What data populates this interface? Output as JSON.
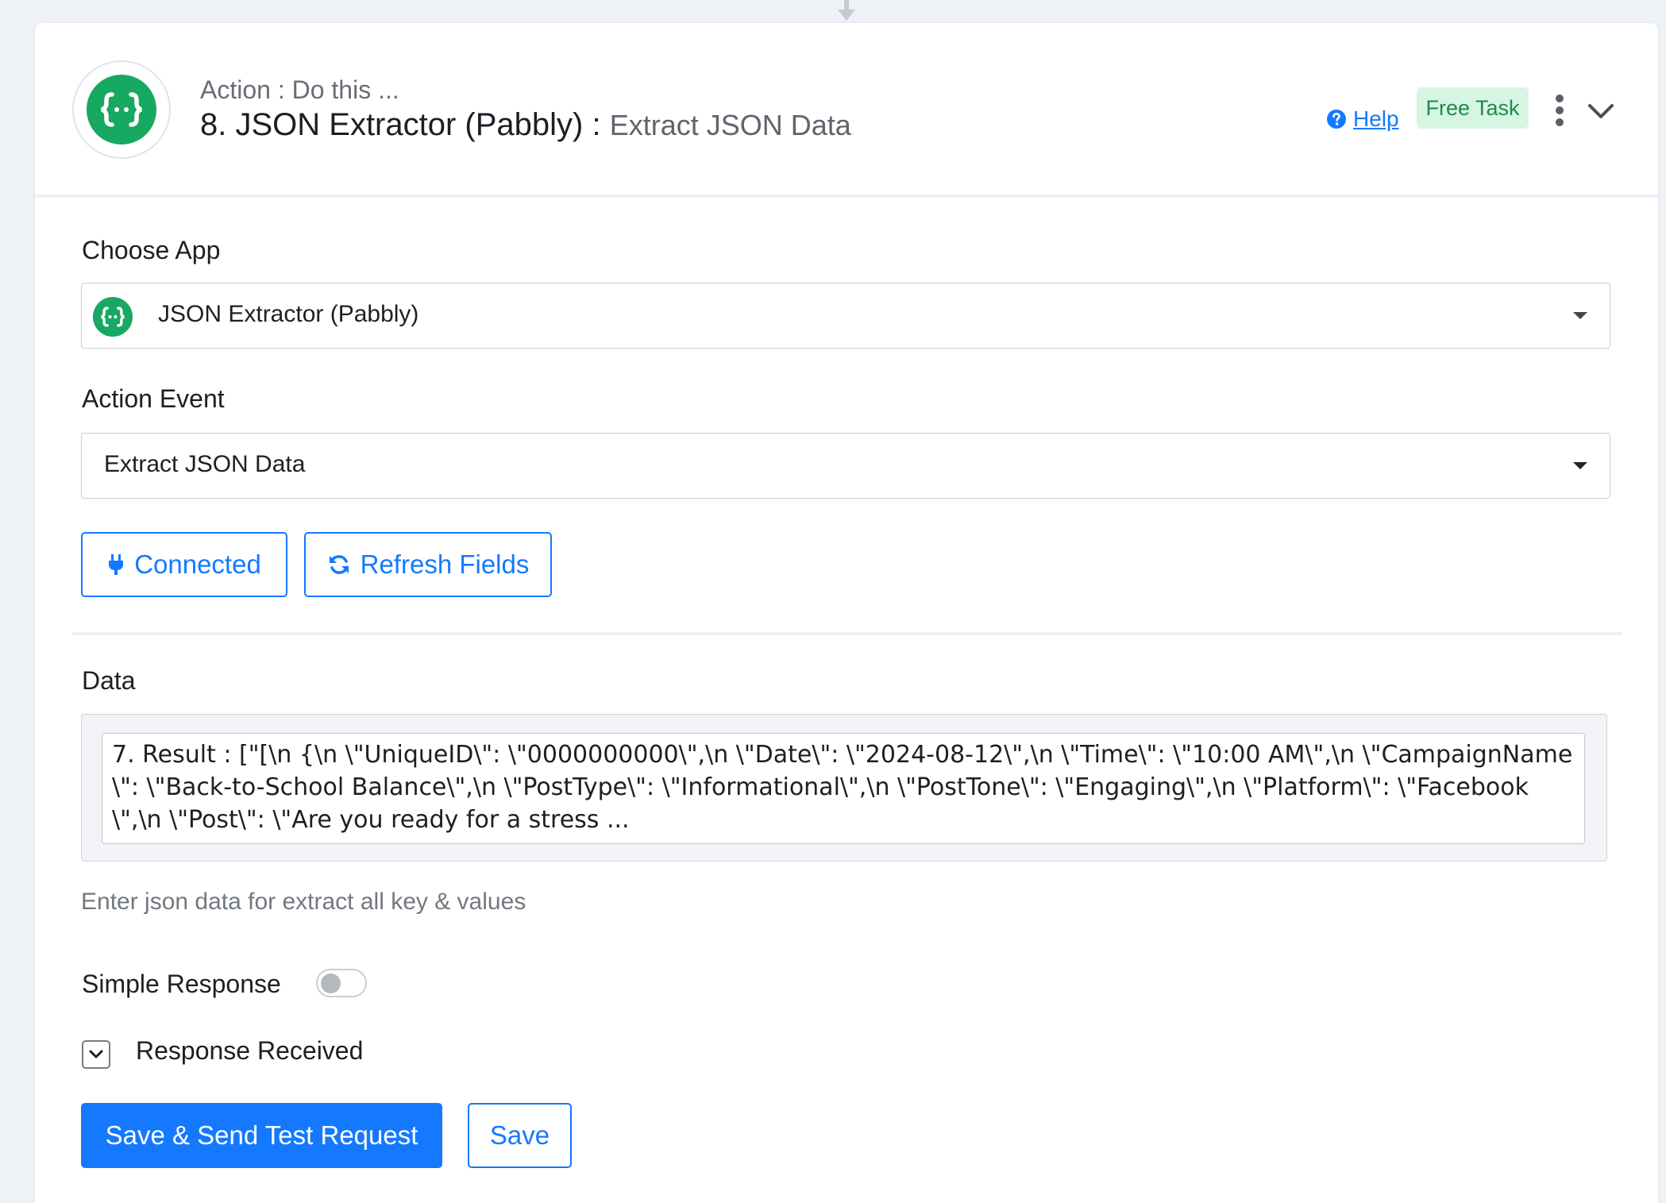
{
  "step": {
    "subtitle": "Action : Do this ...",
    "title_main": "8. JSON Extractor (Pabbly)",
    "title_sep": " : ",
    "title_event": "Extract JSON Data",
    "help_label": "Help",
    "badge": "Free Task"
  },
  "form": {
    "choose_app_label": "Choose App",
    "choose_app_value": "JSON Extractor (Pabbly)",
    "action_event_label": "Action Event",
    "action_event_value": "Extract JSON Data",
    "connected_label": "Connected",
    "refresh_label": "Refresh Fields",
    "data_label": "Data",
    "data_value": "7. Result : [\"[\\n {\\n \\\"UniqueID\\\": \\\"0000000000\\\",\\n \\\"Date\\\": \\\"2024-08-12\\\",\\n \\\"Time\\\": \\\"10:00 AM\\\",\\n \\\"CampaignName\\\": \\\"Back-to-School Balance\\\",\\n \\\"PostType\\\": \\\"Informational\\\",\\n \\\"PostTone\\\": \\\"Engaging\\\",\\n \\\"Platform\\\": \\\"Facebook\\\",\\n \\\"Post\\\": \\\"Are you ready for a stress ...",
    "data_hint": "Enter json data for extract all key & values",
    "simple_response_label": "Simple Response",
    "simple_response_on": false,
    "response_received_label": "Response Received"
  },
  "actions": {
    "save_send_label": "Save & Send Test Request",
    "save_label": "Save"
  },
  "colors": {
    "accent": "#1479ff",
    "brand_green": "#17a862",
    "badge_bg": "#d7f5e3",
    "badge_text": "#1d8c4c"
  }
}
